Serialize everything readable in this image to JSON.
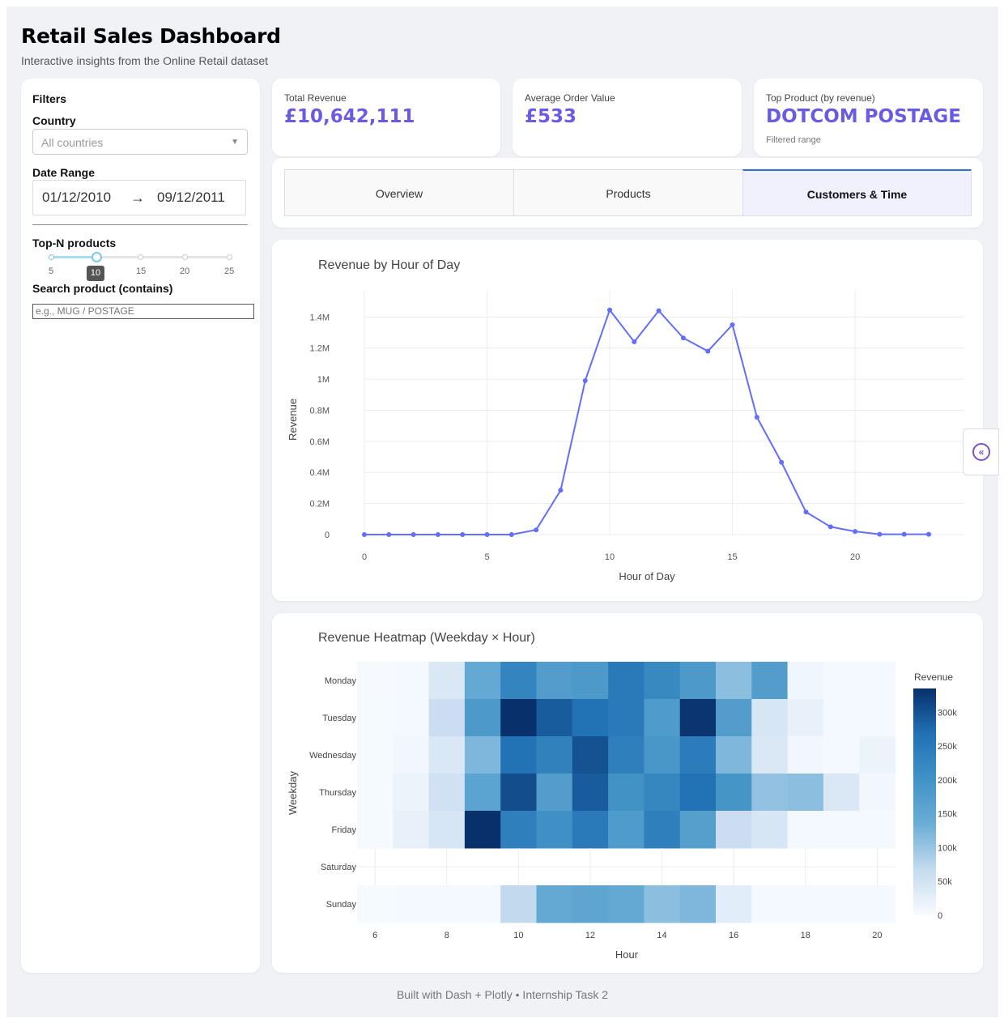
{
  "header": {
    "title": "Retail Sales Dashboard",
    "subtitle": "Interactive insights from the Online Retail dataset"
  },
  "filters": {
    "heading": "Filters",
    "country_label": "Country",
    "country_placeholder": "All countries",
    "date_label": "Date Range",
    "date_start": "01/12/2010",
    "date_arrow": "→",
    "date_end": "09/12/2011",
    "topn_label": "Top-N products",
    "topn_value": "10",
    "topn_ticks": [
      "5",
      "10",
      "15",
      "20",
      "25"
    ],
    "search_label": "Search product (contains)",
    "search_placeholder": "e.g., MUG / POSTAGE"
  },
  "kpis": [
    {
      "label": "Total Revenue",
      "value": "£10,642,111",
      "note": ""
    },
    {
      "label": "Average Order Value",
      "value": "£533",
      "note": ""
    },
    {
      "label": "Top Product (by revenue)",
      "value": "DOTCOM POSTAGE",
      "note": "Filtered range"
    }
  ],
  "tabs": [
    {
      "label": "Overview",
      "active": false
    },
    {
      "label": "Products",
      "active": false
    },
    {
      "label": "Customers & Time",
      "active": true
    }
  ],
  "footer": "Built with Dash + Plotly • Internship Task 2",
  "side_toggle_icon": "collapse-left-icon",
  "colors": {
    "accent": "#6a5ce0",
    "line": "#636efa",
    "tab_active_border": "#2b6fd8"
  },
  "chart_data": [
    {
      "type": "line",
      "title": "Revenue by Hour of Day",
      "xlabel": "Hour of Day",
      "ylabel": "Revenue",
      "x": [
        0,
        1,
        2,
        3,
        4,
        5,
        6,
        7,
        8,
        9,
        10,
        11,
        12,
        13,
        14,
        15,
        16,
        17,
        18,
        19,
        20,
        21,
        22,
        23
      ],
      "y": [
        0,
        0,
        0,
        0,
        0,
        0,
        0,
        30000,
        285000,
        990000,
        1445000,
        1240000,
        1440000,
        1265000,
        1180000,
        1350000,
        755000,
        465000,
        145000,
        50000,
        20000,
        2000,
        2000,
        2000
      ],
      "xlim": [
        0,
        23
      ],
      "ylim": [
        0,
        1480000
      ],
      "xticks": [
        "0",
        "5",
        "10",
        "15",
        "20"
      ],
      "yticks": [
        "0",
        "0.2M",
        "0.4M",
        "0.6M",
        "0.8M",
        "1M",
        "1.2M",
        "1.4M"
      ],
      "grid": true
    },
    {
      "type": "heatmap",
      "title": "Revenue Heatmap (Weekday × Hour)",
      "xlabel": "Hour",
      "ylabel": "Weekday",
      "colorbar_title": "Revenue",
      "colorbar_ticks": [
        "0",
        "50k",
        "100k",
        "150k",
        "200k",
        "250k",
        "300k"
      ],
      "zmax": 335000,
      "x": [
        6,
        7,
        8,
        9,
        10,
        11,
        12,
        13,
        14,
        15,
        16,
        17,
        18,
        19,
        20
      ],
      "xticks": [
        "6",
        "8",
        "10",
        "12",
        "14",
        "16",
        "18",
        "20"
      ],
      "y": [
        "Monday",
        "Tuesday",
        "Wednesday",
        "Thursday",
        "Friday",
        "Saturday",
        "Sunday"
      ],
      "z": [
        [
          2000,
          5000,
          40000,
          145000,
          230000,
          175000,
          185000,
          250000,
          220000,
          185000,
          110000,
          175000,
          10000,
          5000,
          5000
        ],
        [
          3000,
          5000,
          60000,
          185000,
          335000,
          290000,
          265000,
          250000,
          180000,
          330000,
          175000,
          45000,
          20000,
          5000,
          5000
        ],
        [
          3000,
          8000,
          40000,
          120000,
          265000,
          235000,
          300000,
          240000,
          190000,
          245000,
          120000,
          40000,
          8000,
          5000,
          15000
        ],
        [
          3000,
          15000,
          55000,
          160000,
          305000,
          175000,
          290000,
          200000,
          225000,
          265000,
          195000,
          105000,
          110000,
          40000,
          8000
        ],
        [
          3000,
          20000,
          45000,
          335000,
          240000,
          205000,
          250000,
          180000,
          240000,
          170000,
          60000,
          45000,
          5000,
          5000,
          5000
        ],
        [
          null,
          null,
          null,
          null,
          null,
          null,
          null,
          null,
          null,
          null,
          null,
          null,
          null,
          null,
          null
        ],
        [
          3000,
          5000,
          5000,
          5000,
          70000,
          145000,
          155000,
          145000,
          110000,
          120000,
          30000,
          5000,
          5000,
          5000,
          5000
        ]
      ]
    }
  ]
}
